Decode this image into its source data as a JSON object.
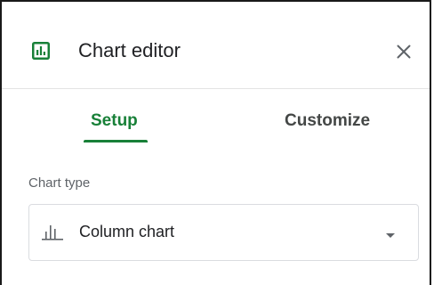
{
  "header": {
    "title": "Chart editor",
    "logo_icon": "bar-chart-icon",
    "close_icon": "close-icon"
  },
  "tabs": [
    {
      "label": "Setup",
      "active": true
    },
    {
      "label": "Customize",
      "active": false
    }
  ],
  "chart_type": {
    "label": "Chart type",
    "selected": "Column chart",
    "icon": "column-chart-icon",
    "dropdown_icon": "dropdown-arrow-icon"
  },
  "colors": {
    "accent": "#188038",
    "text_primary": "#202124",
    "text_secondary": "#5f6368",
    "border": "#dadce0"
  }
}
